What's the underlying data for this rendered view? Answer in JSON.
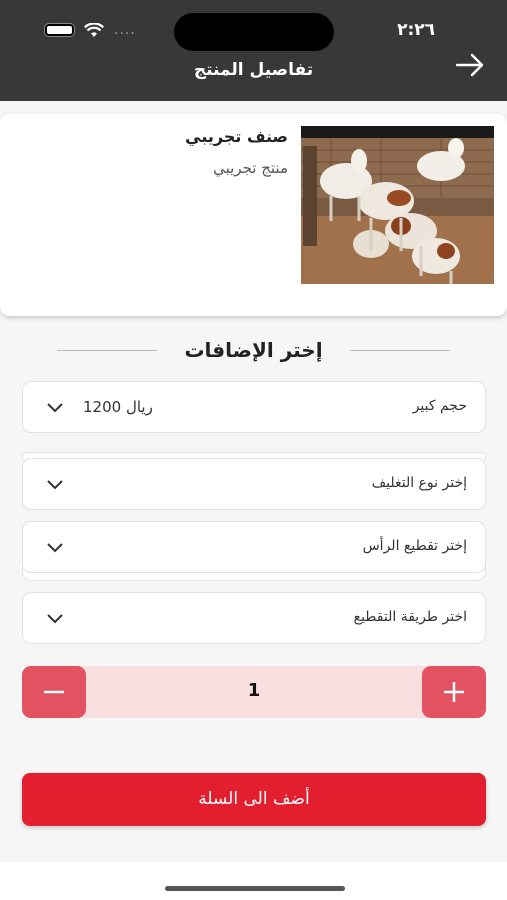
{
  "status_bar": {
    "time": "٢:٢٦",
    "dots": "...."
  },
  "header": {
    "title": "تفاصيل المنتج"
  },
  "product": {
    "name": "صنف تجريبي",
    "description": "منتج تجريبي"
  },
  "section": {
    "title": "إختر الإضافات"
  },
  "options": {
    "size": {
      "label": "حجم كبير",
      "price": "1200 ريال"
    },
    "packaging": {
      "label": "إختر نوع التغليف"
    },
    "head_cut": {
      "label": "إختر  تقطيع الرأس"
    },
    "cutting": {
      "label": "اختر طريقة التقطيع"
    }
  },
  "quantity": {
    "value": "1"
  },
  "cart": {
    "button_label": "أضف الى السلة"
  },
  "colors": {
    "header": "#383838",
    "accent": "#e31f2f",
    "qty_button": "#e35260",
    "qty_bg": "#f8dede"
  },
  "icons": [
    "back-arrow-icon",
    "chevron-down-icon",
    "minus-icon",
    "plus-icon",
    "wifi-icon",
    "battery-icon"
  ]
}
